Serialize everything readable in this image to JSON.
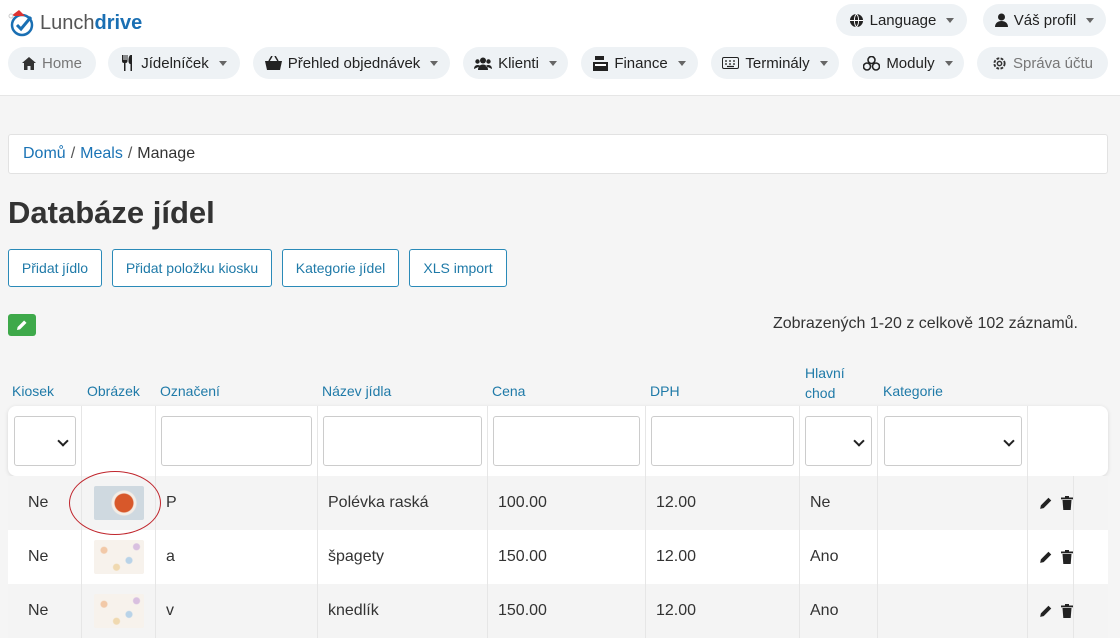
{
  "brand": {
    "name_a": "Lunch",
    "name_b": "drive"
  },
  "top_nav_right": {
    "language": "Language",
    "profile": "Váš profil"
  },
  "nav": {
    "home": "Home",
    "menu": "Jídelníček",
    "orders": "Přehled objednávek",
    "clients": "Klienti",
    "finance": "Finance",
    "terminals": "Terminály",
    "modules": "Moduly",
    "account": "Správa účtu"
  },
  "breadcrumb": {
    "home": "Domů",
    "meals": "Meals",
    "current": "Manage"
  },
  "page_title": "Databáze jídel",
  "actions": {
    "add_meal": "Přidat jídlo",
    "add_kiosk_item": "Přidat položku kiosku",
    "meal_categories": "Kategorie jídel",
    "xls_import": "XLS import"
  },
  "summary": "Zobrazených 1-20 z celkově 102 záznamů.",
  "table": {
    "headers": {
      "kiosk": "Kiosek",
      "image": "Obrázek",
      "code": "Označení",
      "name": "Název jídla",
      "price": "Cena",
      "vat": "DPH",
      "main_course_1": "Hlavní",
      "main_course_2": "chod",
      "category": "Kategorie"
    },
    "rows": [
      {
        "kiosk": "Ne",
        "image": "soup",
        "code": "P",
        "name": "Polévka raská",
        "price": "100.00",
        "vat": "12.00",
        "main_course": "Ne",
        "category": ""
      },
      {
        "kiosk": "Ne",
        "image": "pattern",
        "code": "a",
        "name": "špagety",
        "price": "150.00",
        "vat": "12.00",
        "main_course": "Ano",
        "category": ""
      },
      {
        "kiosk": "Ne",
        "image": "pattern",
        "code": "v",
        "name": "knedlík",
        "price": "150.00",
        "vat": "12.00",
        "main_course": "Ano",
        "category": ""
      }
    ]
  },
  "colors": {
    "link": "#1a73b5",
    "accent_green": "#3ea94a",
    "highlight_circle": "#c0262d"
  }
}
